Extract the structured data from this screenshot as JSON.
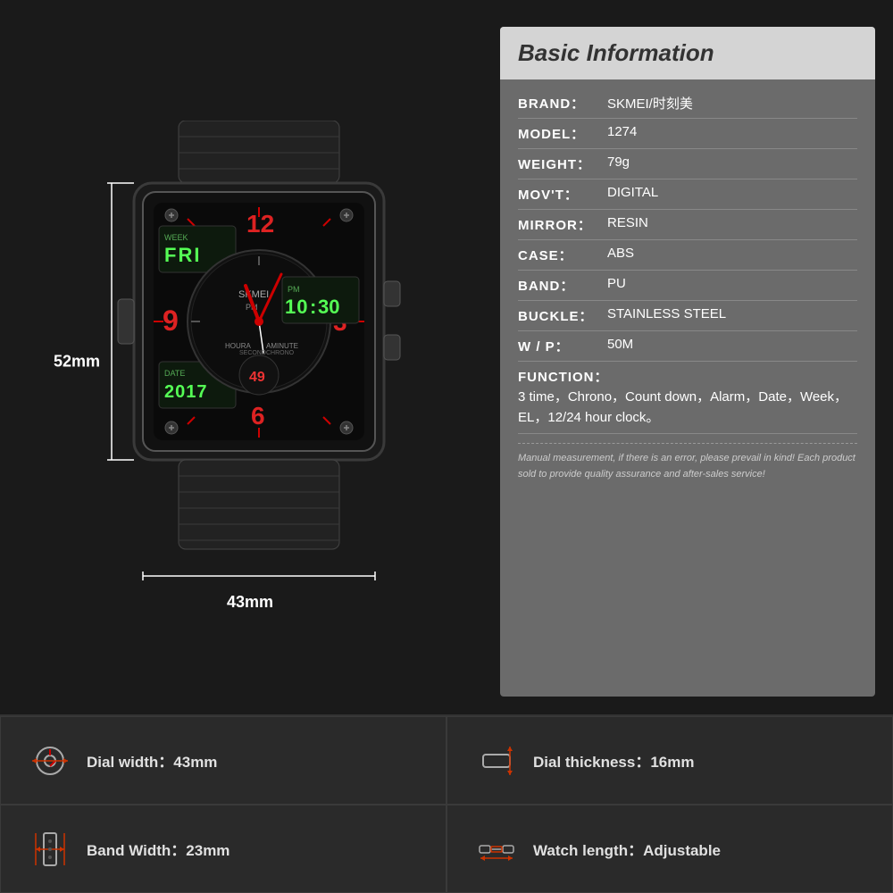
{
  "header": {
    "title": "Basic Information"
  },
  "info": {
    "brand_label": "BRAND：",
    "brand_value": "SKMEI/时刻美",
    "model_label": "MODEL：",
    "model_value": "1274",
    "weight_label": "WEIGHT：",
    "weight_value": "79g",
    "movt_label": "MOV'T：",
    "movt_value": "DIGITAL",
    "mirror_label": "MIRROR：",
    "mirror_value": "RESIN",
    "case_label": "CASE：",
    "case_value": "ABS",
    "band_label": "BAND：",
    "band_value": "PU",
    "buckle_label": "BUCKLE：",
    "buckle_value": "STAINLESS STEEL",
    "wp_label": "W / P：",
    "wp_value": "50M",
    "function_label": "FUNCTION：",
    "function_value": "3 time，Chrono，Count down，Alarm，Date，Week，EL，12/24 hour clock。",
    "note": "Manual measurement, if there is an error, please prevail in kind!\nEach product sold to provide quality assurance and after-sales service!"
  },
  "dimensions": {
    "height_label": "52mm",
    "width_label": "43mm"
  },
  "specs": {
    "dial_width_label": "Dial width：",
    "dial_width_value": "43mm",
    "dial_thickness_label": "Dial thickness：",
    "dial_thickness_value": "16mm",
    "band_width_label": "Band Width：",
    "band_width_value": "23mm",
    "watch_length_label": "Watch length：",
    "watch_length_value": "Adjustable"
  }
}
